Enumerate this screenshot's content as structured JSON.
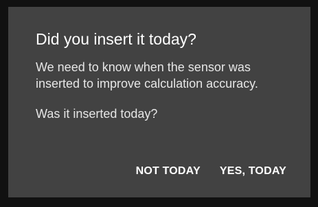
{
  "dialog": {
    "title": "Did you insert it today?",
    "message": "We need to know when the sensor was inserted to improve calculation accuracy.",
    "question": "Was it inserted today?",
    "buttons": {
      "negative": "NOT TODAY",
      "positive": "YES, TODAY"
    }
  },
  "colors": {
    "background": "#111111",
    "dialog": "#424242",
    "text": "#ffffff"
  }
}
